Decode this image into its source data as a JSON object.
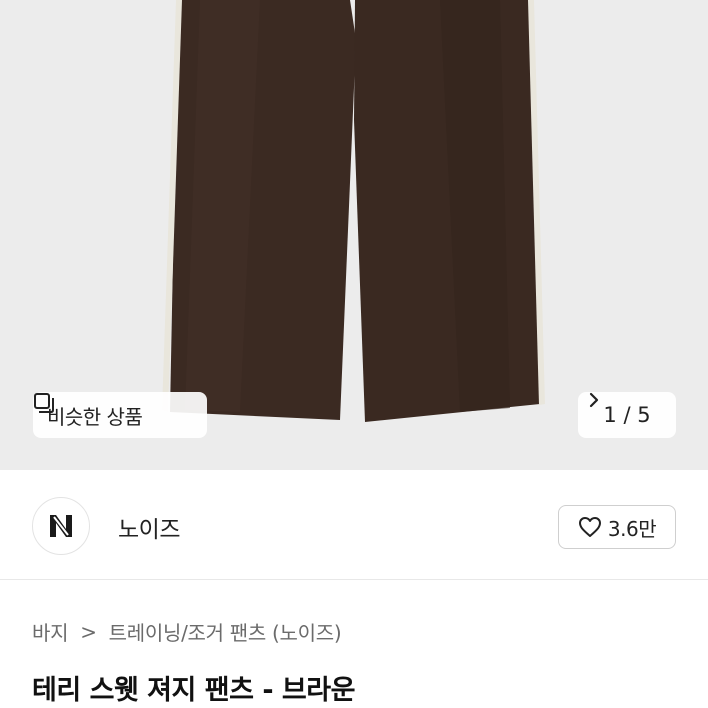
{
  "product_image": {
    "alt": "brown terry sweat jersey pants",
    "pants_color": "#3b2a22",
    "stripe_color": "#e9e6dc",
    "background": "#ececec"
  },
  "similar_button": {
    "icon": "square-stack-icon",
    "label": "비슷한 상품"
  },
  "pager": {
    "label": "1 / 5",
    "icon": "chevron-right-icon"
  },
  "shop": {
    "logo_icon": "noise-logo-icon",
    "name": "노이즈"
  },
  "like": {
    "icon": "heart-outline-icon",
    "count": "3.6만"
  },
  "breadcrumb": {
    "items": [
      "바지",
      "트레이닝/조거 팬츠 (노이즈)"
    ],
    "separator": ">"
  },
  "product": {
    "title": "테리 스웻 져지 팬츠 - 브라운"
  }
}
